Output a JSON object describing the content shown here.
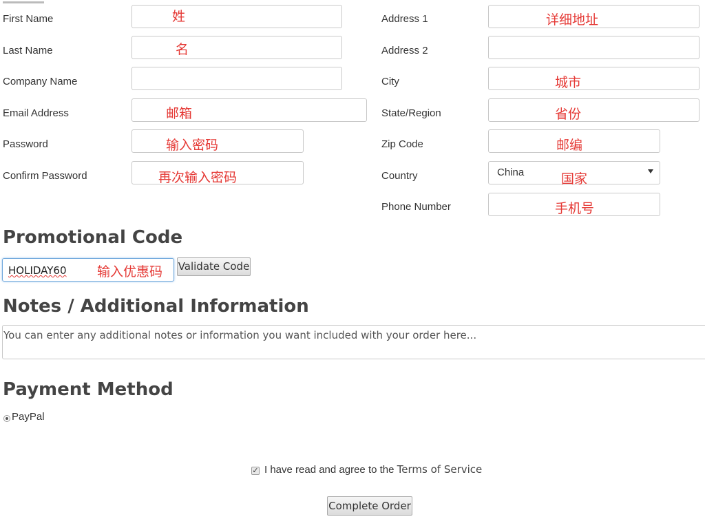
{
  "form": {
    "left": [
      {
        "label": "First Name",
        "note": "姓"
      },
      {
        "label": "Last Name",
        "note": "名"
      },
      {
        "label": "Company Name",
        "note": ""
      },
      {
        "label": "Email Address",
        "note": "邮箱"
      },
      {
        "label": "Password",
        "note": "输入密码"
      },
      {
        "label": "Confirm Password",
        "note": "再次输入密码"
      }
    ],
    "right": [
      {
        "label": "Address 1",
        "note": "详细地址"
      },
      {
        "label": "Address 2",
        "note": ""
      },
      {
        "label": "City",
        "note": "城市"
      },
      {
        "label": "State/Region",
        "note": "省份"
      },
      {
        "label": "Zip Code",
        "note": "邮编"
      },
      {
        "label": "Country",
        "note": "国家",
        "value": "China"
      },
      {
        "label": "Phone Number",
        "note": "手机号"
      }
    ]
  },
  "promo": {
    "heading": "Promotional Code",
    "value": "HOLIDAY60",
    "note": "输入优惠码",
    "button": "Validate Code"
  },
  "notes": {
    "heading": "Notes / Additional Information",
    "placeholder": "You can enter any additional notes or information you want included with your order here..."
  },
  "payment": {
    "heading": "Payment Method",
    "option": "PayPal"
  },
  "terms": {
    "text": "I have read and agree to the",
    "link": "Terms of Service"
  },
  "submit": {
    "label": "Complete Order"
  }
}
